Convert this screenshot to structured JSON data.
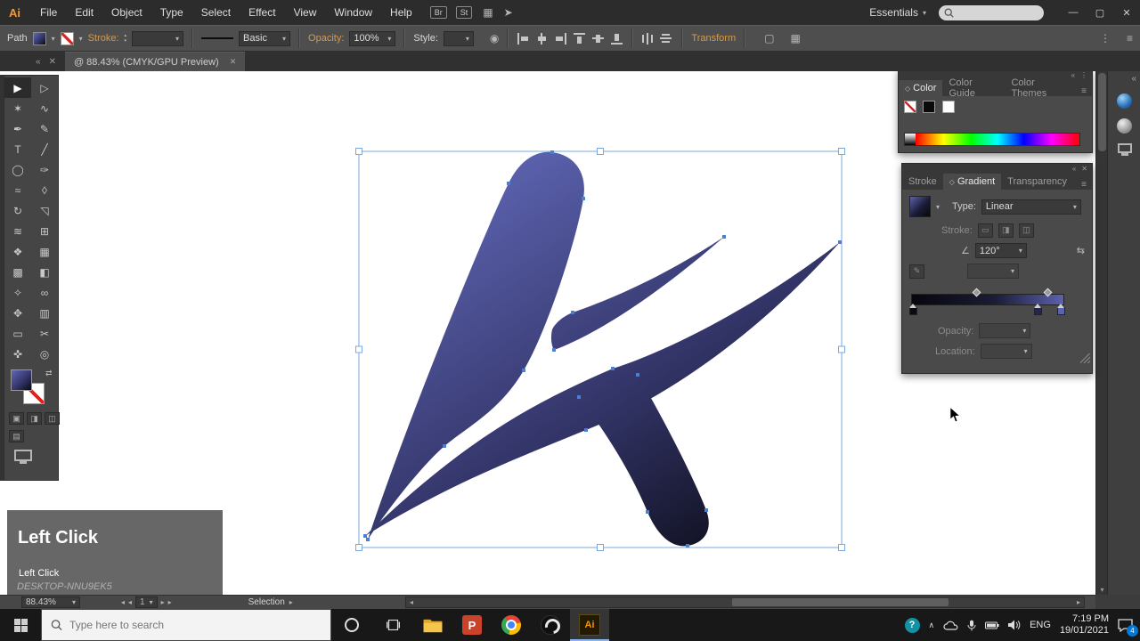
{
  "icons": {
    "dropdown": "▾",
    "spin_up": "▴",
    "spin_down": "▾",
    "collapse": "«",
    "menu": "≡",
    "kebab": "⋮",
    "close": "✕",
    "cycle": "◇",
    "angle": "∠",
    "reverse": "⇆",
    "swap": "⇄",
    "left": "◂",
    "right": "▸",
    "up": "▴",
    "down": "▾",
    "chevron_up": "∧",
    "grid": "▦",
    "share": "➤",
    "minimize": "—",
    "restore": "▢",
    "help": "?",
    "globe": "◉",
    "draw_normal": "▣",
    "draw_behind": "◨",
    "draw_inside": "◫",
    "screen_mode": "▤",
    "edit_gradient": "✎",
    "stroke_opt1": "▭",
    "stroke_opt2": "◨",
    "stroke_opt3": "◫"
  },
  "menubar": {
    "logo": "Ai",
    "items": [
      "File",
      "Edit",
      "Object",
      "Type",
      "Select",
      "Effect",
      "View",
      "Window",
      "Help"
    ],
    "bridge": "Br",
    "stock": "St",
    "workspace": "Essentials"
  },
  "controlbar": {
    "selection_type": "Path",
    "stroke_label": "Stroke:",
    "brush": "Basic",
    "opacity_label": "Opacity:",
    "opacity_value": "100%",
    "style_label": "Style:",
    "transform": "Transform"
  },
  "document_tab": {
    "title": "@ 88.43% (CMYK/GPU Preview)"
  },
  "tools": [
    {
      "name": "selection",
      "glyph": "▶"
    },
    {
      "name": "direct-selection",
      "glyph": "▷"
    },
    {
      "name": "magic-wand",
      "glyph": "✶"
    },
    {
      "name": "lasso",
      "glyph": "∿"
    },
    {
      "name": "pen",
      "glyph": "✒"
    },
    {
      "name": "curvature",
      "glyph": "✎"
    },
    {
      "name": "type",
      "glyph": "T"
    },
    {
      "name": "line",
      "glyph": "╱"
    },
    {
      "name": "ellipse",
      "glyph": "◯"
    },
    {
      "name": "paintbrush",
      "glyph": "✑"
    },
    {
      "name": "shaper",
      "glyph": "≈"
    },
    {
      "name": "eraser",
      "glyph": "◊"
    },
    {
      "name": "rotate",
      "glyph": "↻"
    },
    {
      "name": "scale",
      "glyph": "◹"
    },
    {
      "name": "width",
      "glyph": "≋"
    },
    {
      "name": "free-transform",
      "glyph": "⊞"
    },
    {
      "name": "shape-builder",
      "glyph": "❖"
    },
    {
      "name": "perspective-grid",
      "glyph": "▦"
    },
    {
      "name": "mesh",
      "glyph": "▩"
    },
    {
      "name": "gradient",
      "glyph": "◧"
    },
    {
      "name": "eyedropper",
      "glyph": "✧"
    },
    {
      "name": "blend",
      "glyph": "∞"
    },
    {
      "name": "symbol-sprayer",
      "glyph": "✥"
    },
    {
      "name": "column-graph",
      "glyph": "▥"
    },
    {
      "name": "artboard",
      "glyph": "▭"
    },
    {
      "name": "slice",
      "glyph": "✂"
    },
    {
      "name": "hand",
      "glyph": "✜"
    },
    {
      "name": "zoom",
      "glyph": "◎"
    }
  ],
  "color_panel": {
    "tabs": [
      "Color",
      "Color Guide",
      "Color Themes"
    ]
  },
  "gradient_panel": {
    "tabs": [
      "Stroke",
      "Gradient",
      "Transparency"
    ],
    "type_label": "Type:",
    "type_value": "Linear",
    "stroke_label": "Stroke:",
    "angle_value": "120°",
    "opacity_label": "Opacity:",
    "location_label": "Location:",
    "slider_from": "#07070d",
    "slider_mid": "#1b1c36",
    "slider_to": "#5c62ae"
  },
  "artwork": {
    "gradient_from": "#6067b6",
    "gradient_mid": "#34366a",
    "gradient_to": "#0a0a14",
    "selection_color": "#7aa9dd"
  },
  "overlay": {
    "title": "Left Click",
    "subtitle": "Left Click",
    "watermark": "DESKTOP-NNU9EK5"
  },
  "statusbar": {
    "zoom": "88.43%",
    "artboard": "1",
    "tool": "Selection"
  },
  "taskbar": {
    "search_placeholder": "Type here to search",
    "powerpoint": "P",
    "ai": "Ai",
    "language": "ENG",
    "time": "7:19 PM",
    "date": "19/01/2021",
    "badge": "4"
  }
}
